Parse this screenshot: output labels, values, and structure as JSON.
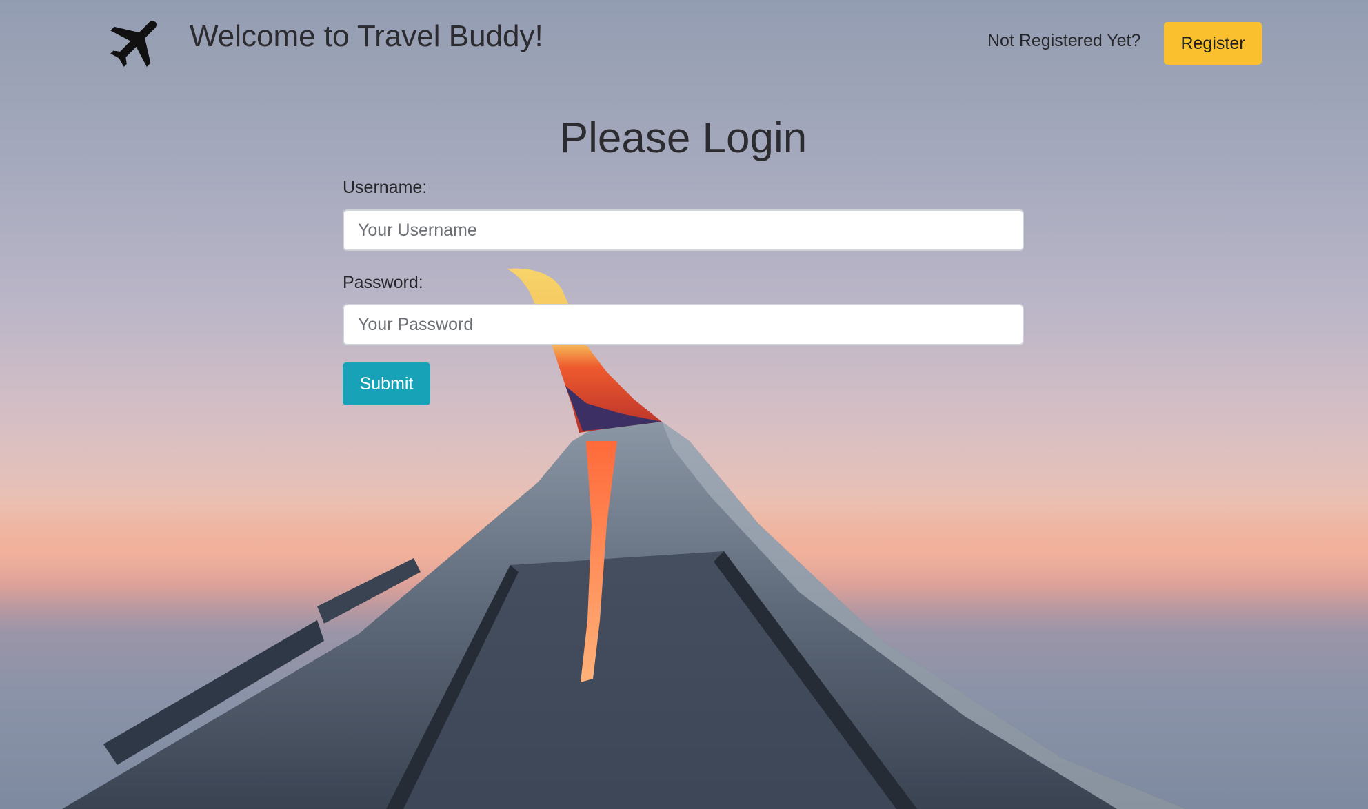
{
  "header": {
    "logo_icon": "airplane-icon",
    "title": "Welcome to Travel Buddy!",
    "not_registered_text": "Not Registered Yet?",
    "register_label": "Register"
  },
  "login": {
    "title": "Please Login",
    "username_label": "Username:",
    "username_placeholder": "Your Username",
    "username_value": "",
    "password_label": "Password:",
    "password_placeholder": "Your Password",
    "password_value": "",
    "submit_label": "Submit"
  },
  "colors": {
    "register_button": "#fbc02d",
    "submit_button": "#17a2b8",
    "text_dark": "#2b2b30"
  }
}
